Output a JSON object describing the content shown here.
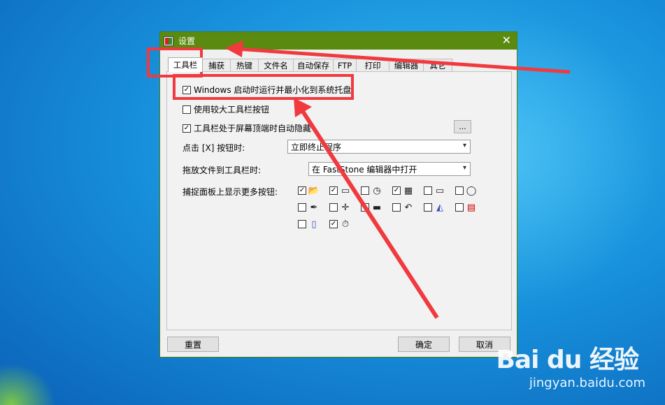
{
  "window": {
    "title": "设置",
    "close": "✕"
  },
  "tabs": [
    {
      "label": "工具栏",
      "active": true
    },
    {
      "label": "捕获"
    },
    {
      "label": "热键"
    },
    {
      "label": "文件名"
    },
    {
      "label": "自动保存"
    },
    {
      "label": "FTP"
    },
    {
      "label": "打印"
    },
    {
      "label": "编辑器"
    },
    {
      "label": "其它"
    }
  ],
  "options": {
    "start_minimized": {
      "label": "Windows 启动时运行并最小化到系统托盘",
      "checked": true
    },
    "large_toolbar": {
      "label": "使用较大工具栏按钮",
      "checked": false
    },
    "auto_hide": {
      "label": "工具栏处于屏幕顶端时自动隐藏",
      "checked": true
    },
    "more_button_label": "..."
  },
  "close_click": {
    "label": "点击 [X] 按钮时:",
    "value": "立即终止程序"
  },
  "drag_file": {
    "label": "拖放文件到工具栏时:",
    "value": "在 FastStone 编辑器中打开"
  },
  "capture_panel": {
    "label": "捕捉面板上显示更多按钮:",
    "items": [
      {
        "icon": "folder-open-icon",
        "glyph": "📂",
        "checked": true
      },
      {
        "icon": "window-icon",
        "glyph": "▭",
        "checked": true
      },
      {
        "icon": "clock-icon",
        "glyph": "◷",
        "checked": false
      },
      {
        "icon": "film-icon",
        "glyph": "▦",
        "checked": true
      },
      {
        "icon": "rectangle-icon",
        "glyph": "▭",
        "checked": false
      },
      {
        "icon": "magnifier-icon",
        "glyph": "◯",
        "checked": false
      },
      {
        "icon": "eyedropper-icon",
        "glyph": "✒",
        "checked": false
      },
      {
        "icon": "crosshair-icon",
        "glyph": "✛",
        "checked": false
      },
      {
        "icon": "ruler-icon",
        "glyph": "▬",
        "checked": false
      },
      {
        "icon": "undo-icon",
        "glyph": "↶",
        "checked": false
      },
      {
        "icon": "scanner-icon",
        "glyph": "◭",
        "checked": false
      },
      {
        "icon": "pdf-icon",
        "glyph": "▤",
        "checked": false
      },
      {
        "icon": "scroll-icon",
        "glyph": "▯",
        "checked": false
      },
      {
        "icon": "timer-icon",
        "glyph": "⏱",
        "checked": true
      }
    ]
  },
  "buttons": {
    "reset": "重置",
    "ok": "确定",
    "cancel": "取消"
  },
  "watermark": {
    "brand": "Bai du 经验",
    "url": "jingyan.baidu.com"
  },
  "colors": {
    "titlebar": "#5a8a0f",
    "highlight": "#f03a3f"
  }
}
